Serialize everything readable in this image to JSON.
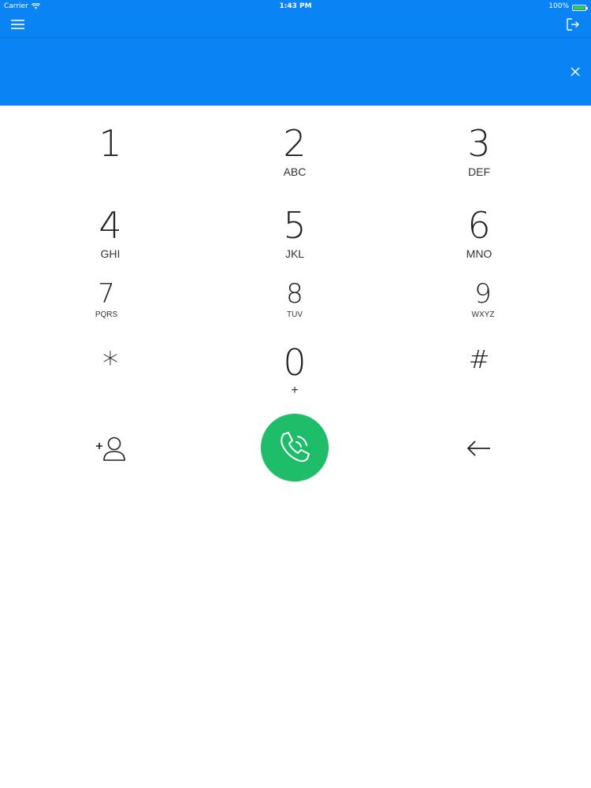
{
  "status_bar": {
    "carrier": "Carrier",
    "time": "1:43 PM",
    "battery": "100%",
    "battery_level": 1.0
  },
  "dial_display": {
    "number": ""
  },
  "keypad": {
    "keys": [
      {
        "digit": "1",
        "letters": ""
      },
      {
        "digit": "2",
        "letters": "ABC"
      },
      {
        "digit": "3",
        "letters": "DEF"
      },
      {
        "digit": "4",
        "letters": "GHI"
      },
      {
        "digit": "5",
        "letters": "JKL"
      },
      {
        "digit": "6",
        "letters": "MNO"
      },
      {
        "digit": "7",
        "letters": "PQRS"
      },
      {
        "digit": "8",
        "letters": "TUV"
      },
      {
        "digit": "9",
        "letters": "WXYZ"
      },
      {
        "digit": "*",
        "letters": ""
      },
      {
        "digit": "0",
        "letters": "+"
      },
      {
        "digit": "#",
        "letters": ""
      }
    ]
  },
  "icons": {
    "menu": "hamburger-menu-icon",
    "logout": "logout-icon",
    "clear": "close-icon",
    "add_contact": "add-contact-icon",
    "call": "phone-icon",
    "backspace": "arrow-left-icon"
  },
  "colors": {
    "header": "#0a84f5",
    "call_button": "#1ebd6a",
    "battery_fill": "#2ed158",
    "text": "#222222",
    "background": "#ffffff"
  }
}
